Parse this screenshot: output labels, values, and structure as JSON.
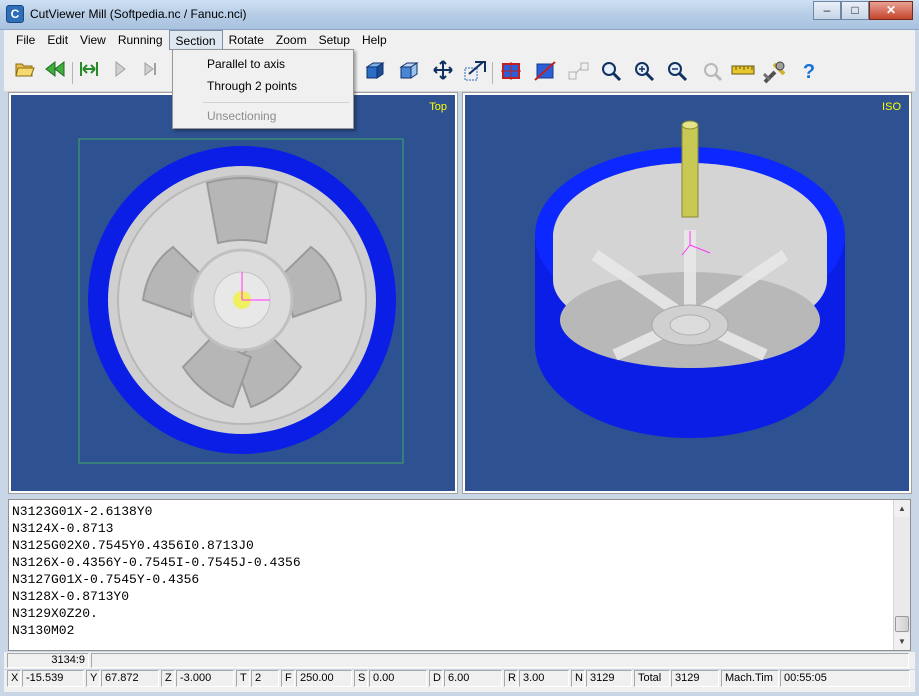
{
  "window": {
    "title": "CutViewer Mill (Softpedia.nc / Fanuc.nci)",
    "app_icon_letter": "C",
    "minimize_glyph": "–",
    "maximize_glyph": "□",
    "close_glyph": "✕"
  },
  "menu": {
    "items": [
      "File",
      "Edit",
      "View",
      "Running",
      "Section",
      "Rotate",
      "Zoom",
      "Setup",
      "Help"
    ],
    "active": "Section"
  },
  "section_menu": {
    "items": [
      {
        "label": "Parallel to axis",
        "enabled": true
      },
      {
        "label": "Through 2 points",
        "enabled": true
      },
      {
        "label": "Unsectioning",
        "enabled": false
      }
    ]
  },
  "toolbar": {
    "icons": [
      "open-icon",
      "rewind-icon",
      "step-back-icon",
      "play-icon",
      "step-forward-icon",
      "solid-view-icon",
      "wireframe-view-icon",
      "pan-icon",
      "zoom-window-icon",
      "section-icon",
      "section-diagonal-icon",
      "measure-icon",
      "zoom-icon",
      "zoom-in-icon",
      "zoom-out-icon",
      "zoom-fit-icon",
      "ruler-icon",
      "tools-icon",
      "help-icon"
    ]
  },
  "viewports": {
    "left_label": "Top",
    "right_label": "ISO",
    "background": "#2e5191",
    "stock_color": "#0a1ee6",
    "part_color": "#c8c8c8",
    "tool_color": "#c8c855",
    "axis_color": "#ff33ff"
  },
  "code": {
    "lines": [
      "N3123G01X-2.6138Y0",
      "N3124X-0.8713",
      "N3125G02X0.7545Y0.4356I0.8713J0",
      "N3126X-0.4356Y-0.7545I-0.7545J-0.4356",
      "N3127G01X-0.7545Y-0.4356",
      "N3128X-0.8713Y0",
      "N3129X0Z20.",
      "N3130M02"
    ]
  },
  "status1": {
    "position": "3134:9"
  },
  "status2": {
    "x_label": "X",
    "x_value": "-15.539",
    "y_label": "Y",
    "y_value": "67.872",
    "z_label": "Z",
    "z_value": "-3.000",
    "t_label": "T",
    "t_value": "2",
    "f_label": "F",
    "f_value": "250.00",
    "s_label": "S",
    "s_value": "0.00",
    "d_label": "D",
    "d_value": "6.00",
    "r_label": "R",
    "r_value": "3.00",
    "n_label": "N",
    "n_value": "3129",
    "total_label": "Total",
    "total_value": "3129",
    "mach_label": "Mach.Tim",
    "mach_value": "00:55:05"
  }
}
